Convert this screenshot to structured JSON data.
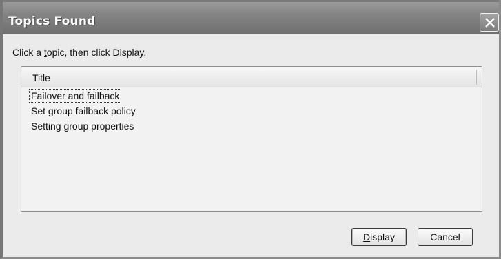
{
  "dialog": {
    "title": "Topics Found",
    "instruction_before": "Click a ",
    "instruction_accel": "t",
    "instruction_after": "opic, then click Display."
  },
  "list": {
    "column_header": "Title",
    "items": [
      {
        "label": "Failover and failback",
        "focused": true
      },
      {
        "label": "Set group failback policy",
        "focused": false
      },
      {
        "label": "Setting group properties",
        "focused": false
      }
    ]
  },
  "buttons": {
    "display_accel": "D",
    "display_rest": "isplay",
    "cancel": "Cancel"
  },
  "icons": {
    "close": "close-icon"
  }
}
